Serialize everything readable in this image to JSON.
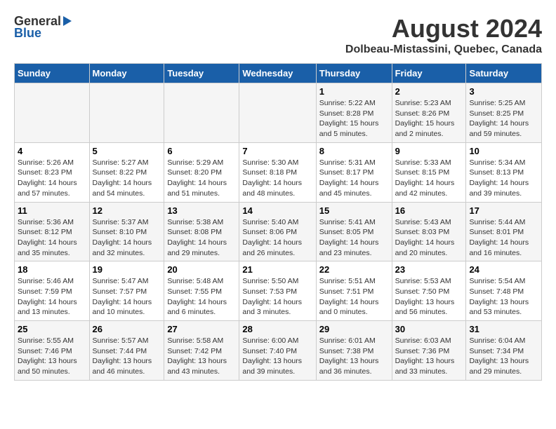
{
  "logo": {
    "general": "General",
    "blue": "Blue"
  },
  "title": {
    "month_year": "August 2024",
    "location": "Dolbeau-Mistassini, Quebec, Canada"
  },
  "headers": [
    "Sunday",
    "Monday",
    "Tuesday",
    "Wednesday",
    "Thursday",
    "Friday",
    "Saturday"
  ],
  "weeks": [
    [
      {
        "day": "",
        "info": ""
      },
      {
        "day": "",
        "info": ""
      },
      {
        "day": "",
        "info": ""
      },
      {
        "day": "",
        "info": ""
      },
      {
        "day": "1",
        "info": "Sunrise: 5:22 AM\nSunset: 8:28 PM\nDaylight: 15 hours\nand 5 minutes."
      },
      {
        "day": "2",
        "info": "Sunrise: 5:23 AM\nSunset: 8:26 PM\nDaylight: 15 hours\nand 2 minutes."
      },
      {
        "day": "3",
        "info": "Sunrise: 5:25 AM\nSunset: 8:25 PM\nDaylight: 14 hours\nand 59 minutes."
      }
    ],
    [
      {
        "day": "4",
        "info": "Sunrise: 5:26 AM\nSunset: 8:23 PM\nDaylight: 14 hours\nand 57 minutes."
      },
      {
        "day": "5",
        "info": "Sunrise: 5:27 AM\nSunset: 8:22 PM\nDaylight: 14 hours\nand 54 minutes."
      },
      {
        "day": "6",
        "info": "Sunrise: 5:29 AM\nSunset: 8:20 PM\nDaylight: 14 hours\nand 51 minutes."
      },
      {
        "day": "7",
        "info": "Sunrise: 5:30 AM\nSunset: 8:18 PM\nDaylight: 14 hours\nand 48 minutes."
      },
      {
        "day": "8",
        "info": "Sunrise: 5:31 AM\nSunset: 8:17 PM\nDaylight: 14 hours\nand 45 minutes."
      },
      {
        "day": "9",
        "info": "Sunrise: 5:33 AM\nSunset: 8:15 PM\nDaylight: 14 hours\nand 42 minutes."
      },
      {
        "day": "10",
        "info": "Sunrise: 5:34 AM\nSunset: 8:13 PM\nDaylight: 14 hours\nand 39 minutes."
      }
    ],
    [
      {
        "day": "11",
        "info": "Sunrise: 5:36 AM\nSunset: 8:12 PM\nDaylight: 14 hours\nand 35 minutes."
      },
      {
        "day": "12",
        "info": "Sunrise: 5:37 AM\nSunset: 8:10 PM\nDaylight: 14 hours\nand 32 minutes."
      },
      {
        "day": "13",
        "info": "Sunrise: 5:38 AM\nSunset: 8:08 PM\nDaylight: 14 hours\nand 29 minutes."
      },
      {
        "day": "14",
        "info": "Sunrise: 5:40 AM\nSunset: 8:06 PM\nDaylight: 14 hours\nand 26 minutes."
      },
      {
        "day": "15",
        "info": "Sunrise: 5:41 AM\nSunset: 8:05 PM\nDaylight: 14 hours\nand 23 minutes."
      },
      {
        "day": "16",
        "info": "Sunrise: 5:43 AM\nSunset: 8:03 PM\nDaylight: 14 hours\nand 20 minutes."
      },
      {
        "day": "17",
        "info": "Sunrise: 5:44 AM\nSunset: 8:01 PM\nDaylight: 14 hours\nand 16 minutes."
      }
    ],
    [
      {
        "day": "18",
        "info": "Sunrise: 5:46 AM\nSunset: 7:59 PM\nDaylight: 14 hours\nand 13 minutes."
      },
      {
        "day": "19",
        "info": "Sunrise: 5:47 AM\nSunset: 7:57 PM\nDaylight: 14 hours\nand 10 minutes."
      },
      {
        "day": "20",
        "info": "Sunrise: 5:48 AM\nSunset: 7:55 PM\nDaylight: 14 hours\nand 6 minutes."
      },
      {
        "day": "21",
        "info": "Sunrise: 5:50 AM\nSunset: 7:53 PM\nDaylight: 14 hours\nand 3 minutes."
      },
      {
        "day": "22",
        "info": "Sunrise: 5:51 AM\nSunset: 7:51 PM\nDaylight: 14 hours\nand 0 minutes."
      },
      {
        "day": "23",
        "info": "Sunrise: 5:53 AM\nSunset: 7:50 PM\nDaylight: 13 hours\nand 56 minutes."
      },
      {
        "day": "24",
        "info": "Sunrise: 5:54 AM\nSunset: 7:48 PM\nDaylight: 13 hours\nand 53 minutes."
      }
    ],
    [
      {
        "day": "25",
        "info": "Sunrise: 5:55 AM\nSunset: 7:46 PM\nDaylight: 13 hours\nand 50 minutes."
      },
      {
        "day": "26",
        "info": "Sunrise: 5:57 AM\nSunset: 7:44 PM\nDaylight: 13 hours\nand 46 minutes."
      },
      {
        "day": "27",
        "info": "Sunrise: 5:58 AM\nSunset: 7:42 PM\nDaylight: 13 hours\nand 43 minutes."
      },
      {
        "day": "28",
        "info": "Sunrise: 6:00 AM\nSunset: 7:40 PM\nDaylight: 13 hours\nand 39 minutes."
      },
      {
        "day": "29",
        "info": "Sunrise: 6:01 AM\nSunset: 7:38 PM\nDaylight: 13 hours\nand 36 minutes."
      },
      {
        "day": "30",
        "info": "Sunrise: 6:03 AM\nSunset: 7:36 PM\nDaylight: 13 hours\nand 33 minutes."
      },
      {
        "day": "31",
        "info": "Sunrise: 6:04 AM\nSunset: 7:34 PM\nDaylight: 13 hours\nand 29 minutes."
      }
    ]
  ]
}
